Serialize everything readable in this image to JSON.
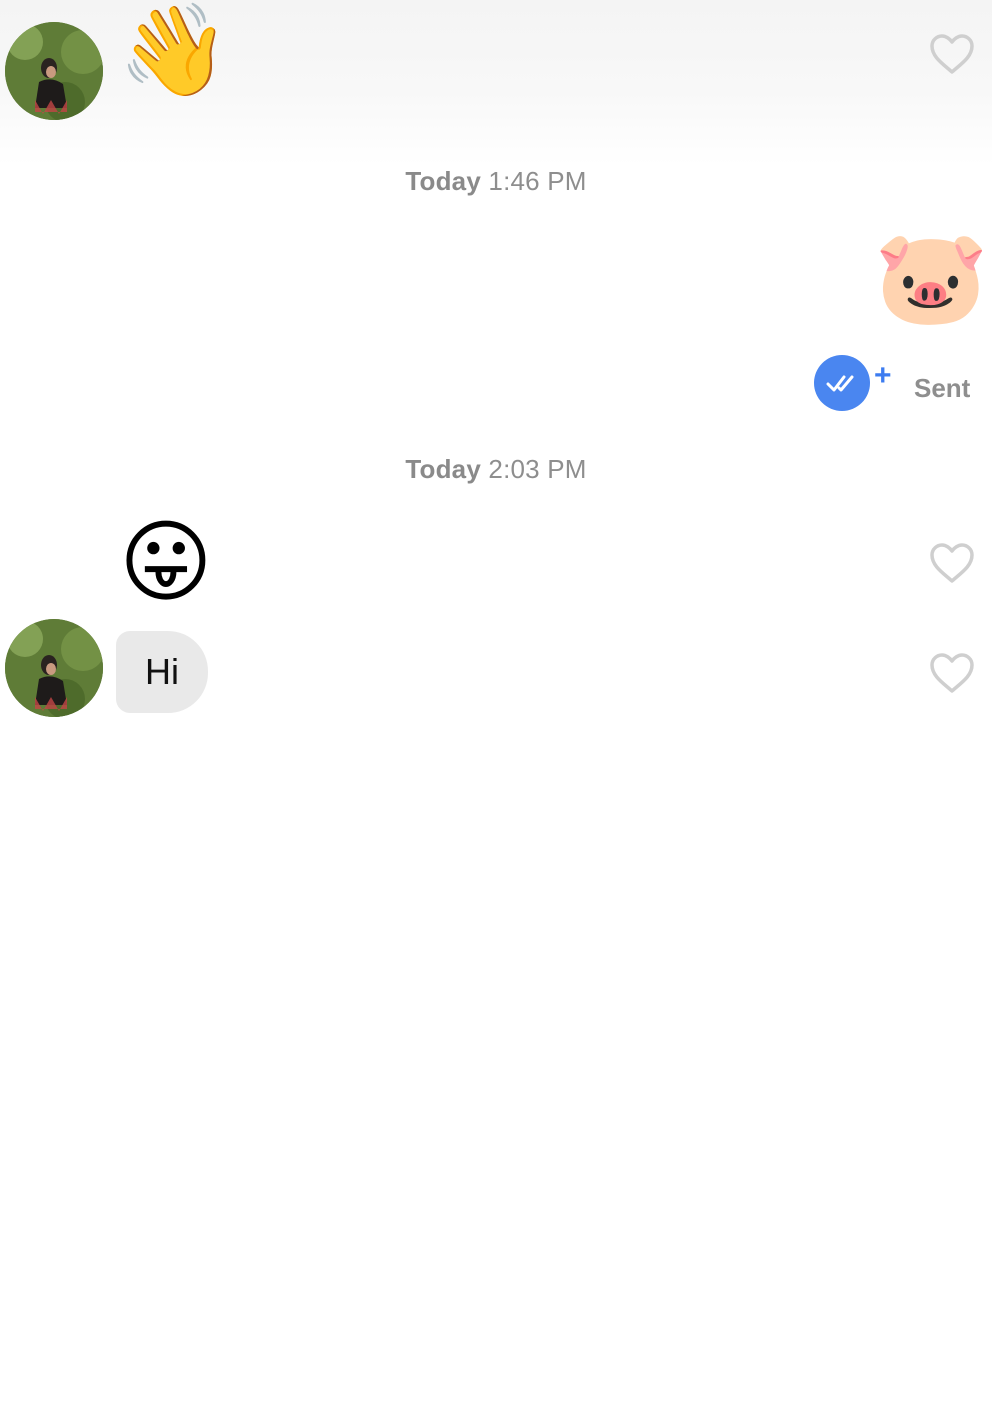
{
  "messages": [
    {
      "from": "other",
      "emoji": "👋"
    },
    {
      "timestamp_day": "Today",
      "timestamp_time": "1:46 PM"
    },
    {
      "from": "me",
      "emoji": "🐷",
      "status": "Sent"
    },
    {
      "timestamp_day": "Today",
      "timestamp_time": "2:03 PM"
    },
    {
      "from": "other",
      "emoji": "😛"
    },
    {
      "from": "other",
      "text": "Hi"
    }
  ],
  "icons": {
    "like": "heart-outline-icon",
    "seen": "double-check-icon",
    "add": "plus-icon"
  },
  "colors": {
    "accent": "#4a86f0",
    "bubble": "#e9e9e9",
    "meta_text": "#8e8e8e"
  }
}
